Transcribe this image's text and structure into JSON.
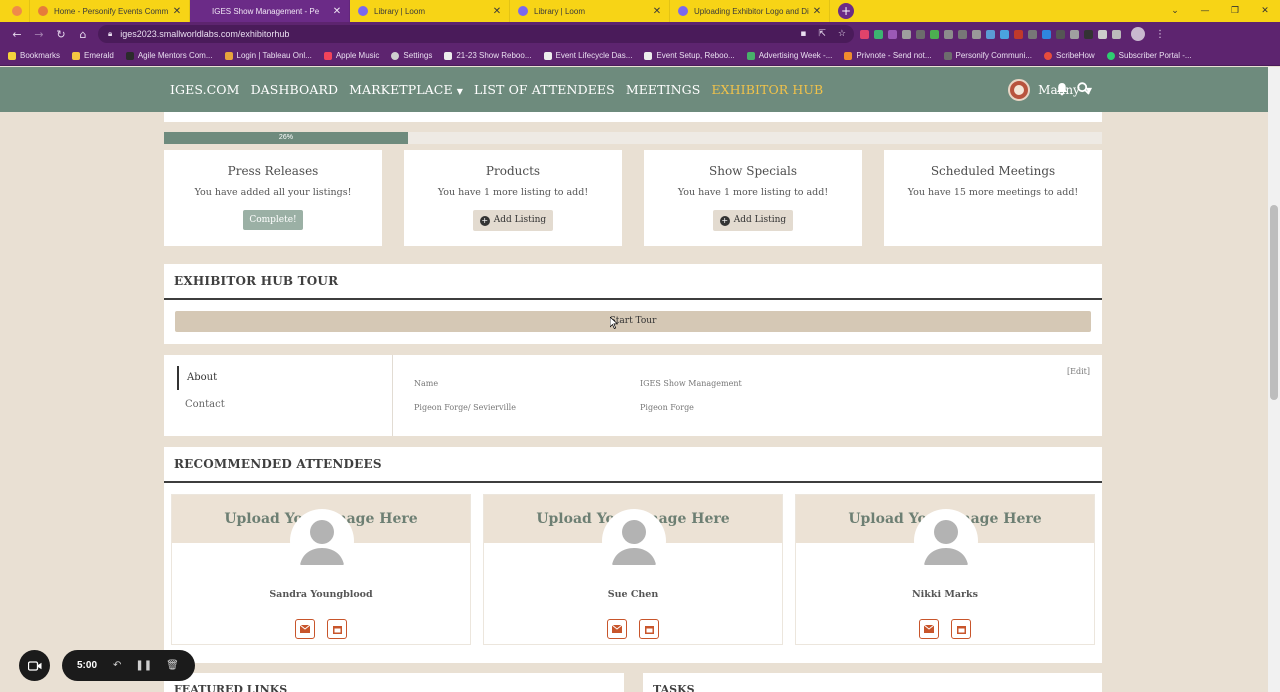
{
  "browser": {
    "tabs": [
      {
        "title": "Home - Personify Events Comm",
        "active": false,
        "icon_color": "#e67c3a"
      },
      {
        "title": "IGES Show Management - Pe",
        "active": true,
        "icon_color": "#e8733c"
      },
      {
        "title": "Library | Loom",
        "active": false,
        "icon_color": "#7b68ee"
      },
      {
        "title": "Library | Loom",
        "active": false,
        "icon_color": "#7b68ee"
      },
      {
        "title": "Uploading Exhibitor Logo and Di",
        "active": false,
        "icon_color": "#7b68ee"
      }
    ],
    "url": "iges2023.smallworldlabs.com/exhibitorhub",
    "bookmarks": [
      "Bookmarks",
      "Emerald",
      "Agile Mentors Com...",
      "Login | Tableau Onl...",
      "Apple Music",
      "Settings",
      "21-23 Show Reboo...",
      "Event Lifecycle Das...",
      "Event Setup, Reboo...",
      "Advertising Week -...",
      "Privnote - Send not...",
      "Personify Communi...",
      "ScribeHow",
      "Subscriber Portal -..."
    ]
  },
  "nav": {
    "links": [
      "IGES.COM",
      "DASHBOARD",
      "MARKETPLACE",
      "LIST OF ATTENDEES",
      "MEETINGS",
      "EXHIBITOR HUB"
    ],
    "user_name": "Manny"
  },
  "progress": {
    "label": "26%",
    "value": 0.26
  },
  "stats": [
    {
      "title": "Press Releases",
      "message": "You have added all your listings!",
      "button": "Complete!"
    },
    {
      "title": "Products",
      "message": "You have 1 more listing to add!",
      "button": "Add Listing"
    },
    {
      "title": "Show Specials",
      "message": "You have 1 more listing to add!",
      "button": "Add Listing"
    },
    {
      "title": "Scheduled Meetings",
      "message": "You have 15 more meetings to add!",
      "button": ""
    }
  ],
  "tour": {
    "heading": "EXHIBITOR HUB TOUR",
    "button": "Start Tour"
  },
  "about": {
    "tabs": [
      "About",
      "Contact"
    ],
    "edit": "[Edit]",
    "name_label": "Name",
    "name_value": "IGES Show Management",
    "city_label": "Pigeon Forge/ Sevierville",
    "city_value": "Pigeon Forge"
  },
  "recommended": {
    "heading": "RECOMMENDED ATTENDEES",
    "banner_text": "Upload Your Image Here",
    "attendees": [
      {
        "name": "Sandra Youngblood"
      },
      {
        "name": "Sue Chen"
      },
      {
        "name": "Nikki Marks"
      }
    ]
  },
  "bottom": {
    "featured": "FEATURED LINKS",
    "tasks": "TASKS"
  },
  "recorder": {
    "time": "5:00"
  },
  "colors": {
    "nav_bg": "#6e8b7d",
    "nav_active": "#f1c24a",
    "page_bg": "#e9e0d3",
    "accent_icon": "#c8552b",
    "browser_purple": "#5d246f",
    "tab_yellow": "#f7d416"
  }
}
